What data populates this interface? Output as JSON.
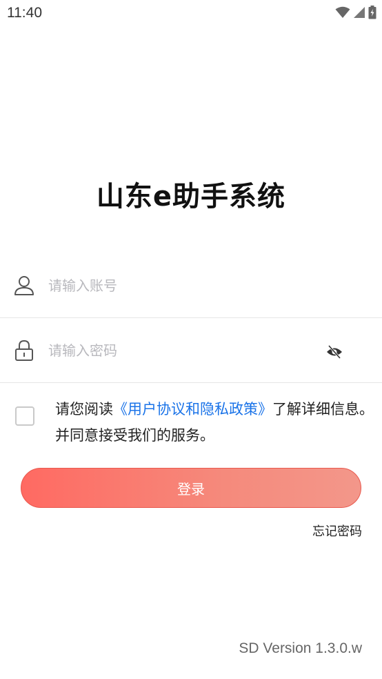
{
  "status_bar": {
    "time": "11:40",
    "icons": [
      "wifi-icon",
      "signal-icon",
      "battery-charging-icon"
    ]
  },
  "app": {
    "title": "山东e助手系统"
  },
  "login_form": {
    "account": {
      "placeholder": "请输入账号",
      "value": "",
      "icon": "user-icon"
    },
    "password": {
      "placeholder": "请输入密码",
      "value": "",
      "icon": "lock-icon",
      "toggle_icon": "eye-off-icon"
    },
    "agreement": {
      "checked": false,
      "prefix": "请您阅读",
      "link": "《用户协议和隐私政策》",
      "suffix": "了解详细信息。并同意接受我们的服务。"
    },
    "login_button": "登录",
    "forgot_password": "忘记密码"
  },
  "footer": {
    "version": "SD Version 1.3.0.w"
  },
  "colors": {
    "accent_start": "#ff6a62",
    "accent_end": "#f3978a",
    "link": "#1a73e8"
  }
}
